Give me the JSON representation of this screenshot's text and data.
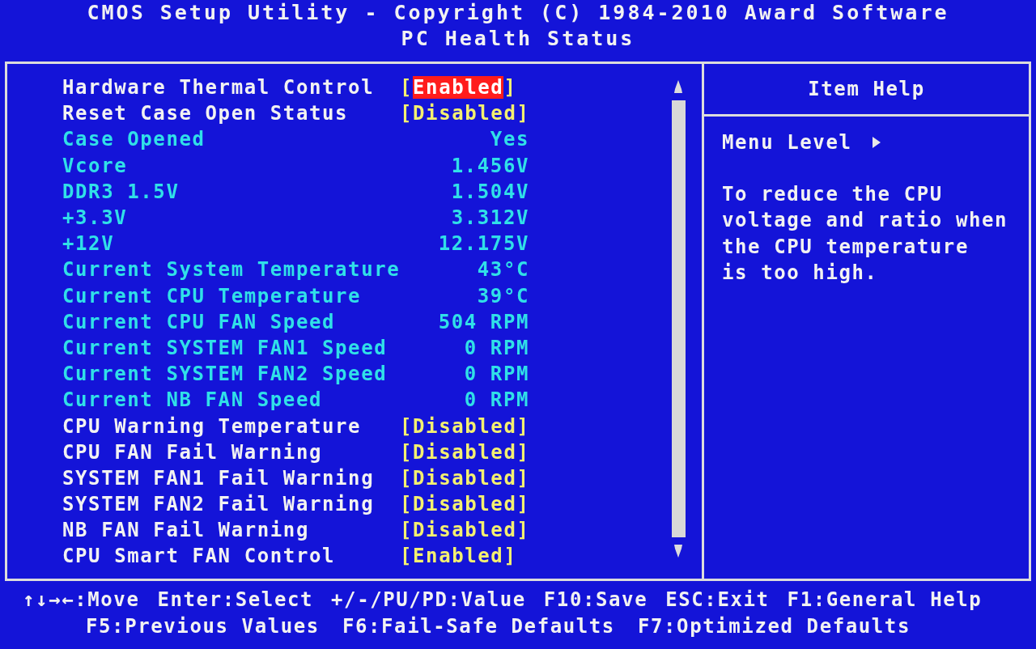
{
  "header": {
    "title": "CMOS Setup Utility - Copyright (C) 1984-2010 Award Software",
    "subtitle": "PC Health Status"
  },
  "items": [
    {
      "kind": "setting",
      "label": "Hardware Thermal Control",
      "value": "[Enabled]",
      "selected": true
    },
    {
      "kind": "setting",
      "label": "Reset Case Open Status",
      "value": "[Disabled]",
      "selected": false
    },
    {
      "kind": "reading",
      "label": "Case Opened",
      "value": "Yes"
    },
    {
      "kind": "reading",
      "label": "Vcore",
      "value": "1.456V"
    },
    {
      "kind": "reading",
      "label": "DDR3 1.5V",
      "value": "1.504V"
    },
    {
      "kind": "reading",
      "label": "+3.3V",
      "value": "3.312V"
    },
    {
      "kind": "reading",
      "label": "+12V",
      "value": "12.175V"
    },
    {
      "kind": "reading",
      "label": "Current System Temperature",
      "value": "43°C"
    },
    {
      "kind": "reading",
      "label": "Current CPU Temperature",
      "value": "39°C"
    },
    {
      "kind": "reading",
      "label": "Current CPU FAN Speed",
      "value": "504 RPM"
    },
    {
      "kind": "reading",
      "label": "Current SYSTEM FAN1 Speed",
      "value": "0 RPM"
    },
    {
      "kind": "reading",
      "label": "Current SYSTEM FAN2 Speed",
      "value": "0 RPM"
    },
    {
      "kind": "reading",
      "label": "Current NB FAN Speed",
      "value": "0 RPM"
    },
    {
      "kind": "setting",
      "label": "CPU Warning Temperature",
      "value": "[Disabled]",
      "selected": false
    },
    {
      "kind": "setting",
      "label": "CPU FAN Fail Warning",
      "value": "[Disabled]",
      "selected": false
    },
    {
      "kind": "setting",
      "label": "SYSTEM FAN1 Fail Warning",
      "value": "[Disabled]",
      "selected": false
    },
    {
      "kind": "setting",
      "label": "SYSTEM FAN2 Fail Warning",
      "value": "[Disabled]",
      "selected": false
    },
    {
      "kind": "setting",
      "label": "NB FAN Fail Warning",
      "value": "[Disabled]",
      "selected": false
    },
    {
      "kind": "setting",
      "label": "CPU Smart FAN Control",
      "value": "[Enabled]",
      "selected": false
    }
  ],
  "help": {
    "title": "Item Help",
    "menu_level": "Menu Level",
    "text": "To reduce the CPU\nvoltage and ratio when\nthe CPU temperature\nis too high."
  },
  "footer": [
    [
      "↑↓→←:Move",
      "Enter:Select",
      "+/-/PU/PD:Value",
      "F10:Save",
      "ESC:Exit",
      "F1:General Help"
    ],
    [
      "F5:Previous Values",
      "F6:Fail-Safe Defaults",
      "F7:Optimized Defaults"
    ]
  ]
}
